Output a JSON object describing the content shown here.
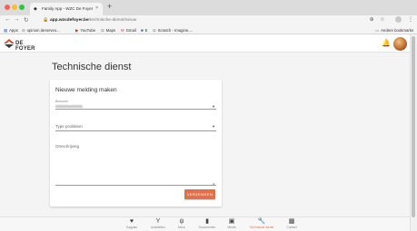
{
  "browser": {
    "tab_title": "Family App - WZC De Foyer",
    "new_tab_glyph": "+",
    "url_host": "app.wzcdefoyer.be",
    "url_path": "/technische-dienst/nieuw",
    "bookmarks": [
      {
        "label": "Apps",
        "icon": "apps-grid-icon"
      },
      {
        "label": "opinion deserves...",
        "icon": "bookmark-icon"
      },
      {
        "label": "YouTube",
        "icon": "youtube-icon"
      },
      {
        "label": "Maps",
        "icon": "maps-icon"
      },
      {
        "label": "Gmail",
        "icon": "gmail-icon"
      },
      {
        "label": "E",
        "icon": "bookmark-icon"
      },
      {
        "label": "Scratch - Imagine,...",
        "icon": "scratch-icon"
      }
    ],
    "other_bookmarks": "Andere bookmarks"
  },
  "app": {
    "logo_text": "DE FOYER",
    "page_title": "Technische dienst"
  },
  "form": {
    "title": "Nieuwe melding maken",
    "resident_label": "Bewoner",
    "problem_type_placeholder": "Type probleem",
    "description_placeholder": "Omschrijving",
    "submit_label": "VERZENDEN"
  },
  "bottom_nav": [
    {
      "label": "Dagplan",
      "icon": "heart-icon",
      "active": false
    },
    {
      "label": "Activiteiten",
      "icon": "activity-icon",
      "active": false
    },
    {
      "label": "Menu",
      "icon": "cutlery-icon",
      "active": false
    },
    {
      "label": "Documenten",
      "icon": "document-icon",
      "active": false
    },
    {
      "label": "Media",
      "icon": "media-icon",
      "active": false
    },
    {
      "label": "Technische dienst",
      "icon": "wrench-icon",
      "active": true
    },
    {
      "label": "Contact",
      "icon": "contact-icon",
      "active": false
    }
  ],
  "colors": {
    "accent": "#e0714f",
    "brand_red": "#d94a2b",
    "brand_dark": "#3a3a3a"
  }
}
